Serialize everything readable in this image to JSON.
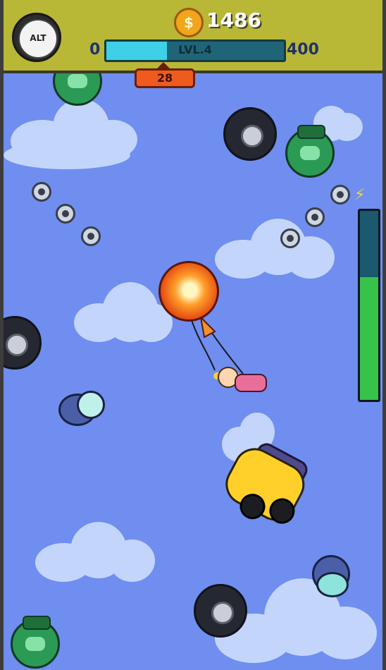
{
  "hud": {
    "altimeter_label": "ALT",
    "coins": "1486",
    "coin_symbol": "$",
    "level": {
      "label": "LVL.4",
      "min": "0",
      "max": "400",
      "progress_fraction": 0.34
    },
    "timer": "28"
  },
  "energy": {
    "icon": "lightning-battery-icon",
    "level_fraction": 0.65,
    "fill_color": "#37c24a"
  },
  "colors": {
    "sky": "#6f8ef0",
    "hud_bar": "#b9b736",
    "xp_fill": "#3ed0e6",
    "timer_badge": "#ef5b1f"
  },
  "entities": [
    "balloon-player",
    "girl-hanging-from-balloon",
    "yellow-taxi-obstacle",
    "black-tire-obstacle",
    "green-robot-obstacle",
    "blue-bug-drone",
    "cog-coin"
  ]
}
